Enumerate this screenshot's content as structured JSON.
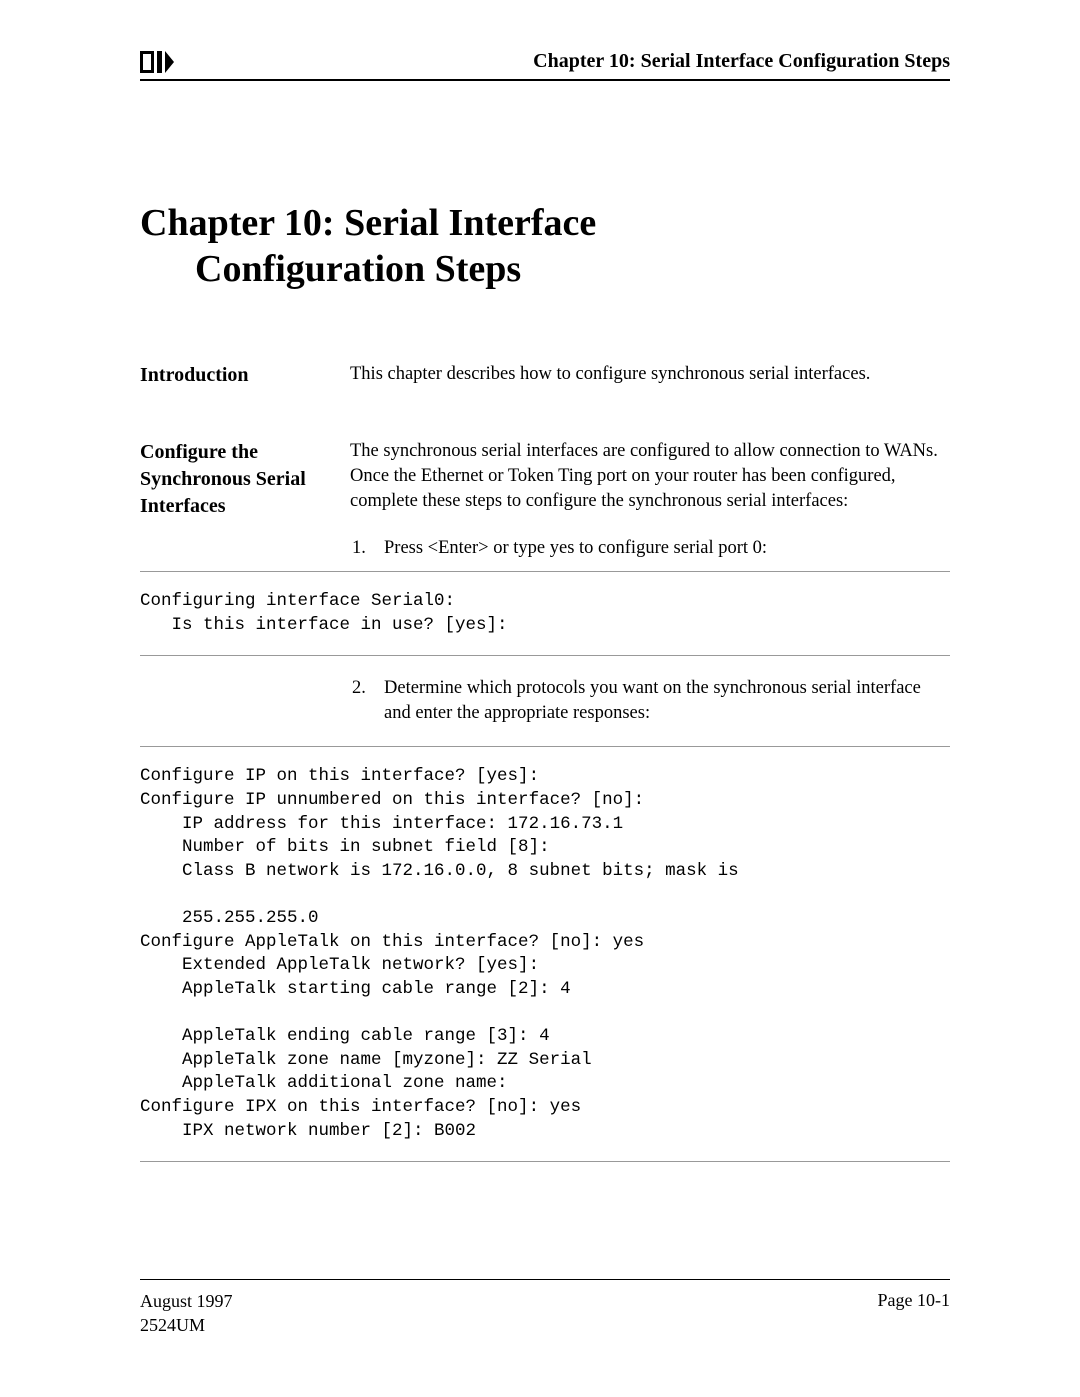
{
  "header": {
    "title": "Chapter 10: Serial Interface Configuration Steps"
  },
  "chapter_title_line1": "Chapter 10: Serial Interface",
  "chapter_title_line2": "Configuration Steps",
  "sections": {
    "intro": {
      "label": "Introduction",
      "body": "This chapter describes how to configure synchronous serial interfaces."
    },
    "configure": {
      "label": "Configure the Synchronous Serial Interfaces",
      "body": "The synchronous serial interfaces are configured to allow connection to WANs. Once the Ethernet or Token Ting port on your router has been configured, complete these steps to configure the synchronous serial interfaces:",
      "step1_num": "1.",
      "step1_text": "Press <Enter> or type yes to configure serial port 0:",
      "step2_num": "2.",
      "step2_text": "Determine which protocols you want on the synchronous serial interface and enter the appropriate responses:"
    }
  },
  "code1": "Configuring interface Serial0:\n   Is this interface in use? [yes]:",
  "code2": "Configure IP on this interface? [yes]:\nConfigure IP unnumbered on this interface? [no]:\n    IP address for this interface: 172.16.73.1\n    Number of bits in subnet field [8]:\n    Class B network is 172.16.0.0, 8 subnet bits; mask is\n\n    255.255.255.0\nConfigure AppleTalk on this interface? [no]: yes\n    Extended AppleTalk network? [yes]:\n    AppleTalk starting cable range [2]: 4\n\n    AppleTalk ending cable range [3]: 4\n    AppleTalk zone name [myzone]: ZZ Serial\n    AppleTalk additional zone name:\nConfigure IPX on this interface? [no]: yes\n    IPX network number [2]: B002",
  "footer": {
    "date": "August 1997",
    "doc_id": "2524UM",
    "page": "Page 10-1"
  }
}
